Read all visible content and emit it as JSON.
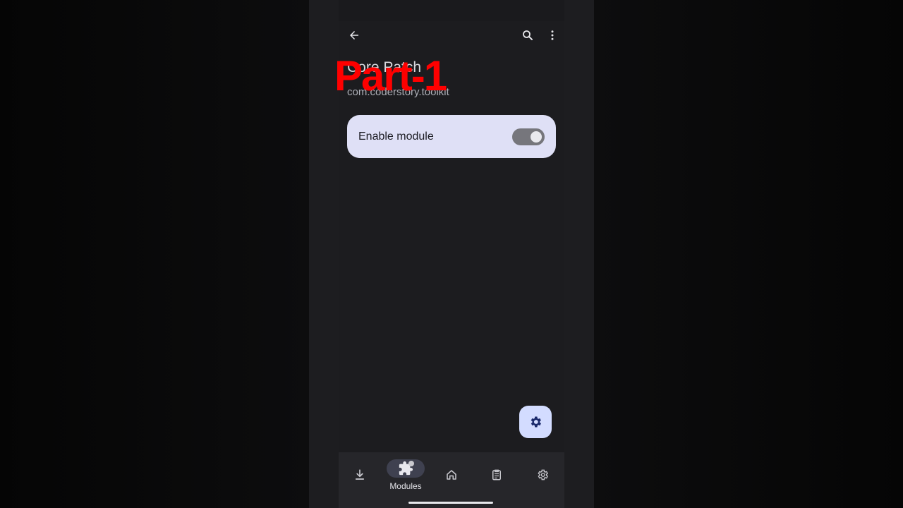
{
  "toolbar": {
    "back_icon": "arrow-back-icon",
    "search_icon": "search-icon",
    "more_icon": "more-vert-icon"
  },
  "module": {
    "title": "Core Patch",
    "package": "com.coderstory.toolkit"
  },
  "overlay": {
    "text": "Part-1",
    "color": "#ff0000"
  },
  "card": {
    "label": "Enable module",
    "enabled": true,
    "background": "#dfe0f6"
  },
  "fab": {
    "icon": "gear-icon",
    "background": "#d3dcff"
  },
  "bottom_nav": {
    "items": [
      {
        "icon": "download-icon",
        "label": ""
      },
      {
        "icon": "extension-icon",
        "label": "Modules",
        "active": true
      },
      {
        "icon": "home-icon",
        "label": ""
      },
      {
        "icon": "logs-icon",
        "label": ""
      },
      {
        "icon": "settings-icon",
        "label": ""
      }
    ]
  },
  "colors": {
    "screen_bg": "#1c1c1f",
    "nav_bg": "#26262a",
    "accent": "#d3dcff"
  }
}
